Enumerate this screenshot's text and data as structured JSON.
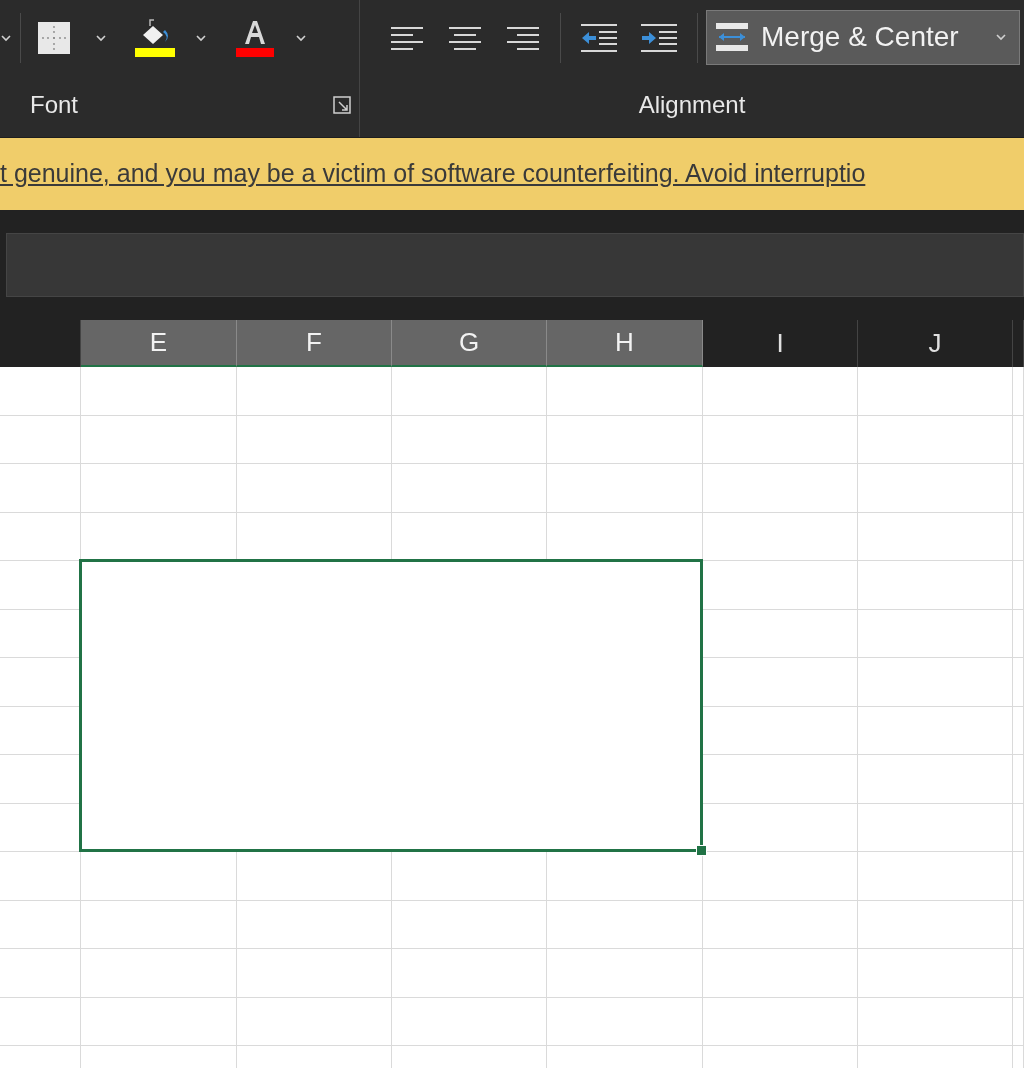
{
  "ribbon": {
    "font_group": {
      "label": "Font",
      "tools": [
        {
          "kind": "borders"
        },
        {
          "kind": "fill",
          "color": "#ffff00"
        },
        {
          "kind": "fontcolor",
          "color": "#ff0000"
        }
      ]
    },
    "alignment_group": {
      "label": "Alignment",
      "tools": [
        {
          "kind": "left"
        },
        {
          "kind": "center"
        },
        {
          "kind": "right"
        },
        {
          "kind": "outdent"
        },
        {
          "kind": "indent"
        }
      ],
      "merge_button": {
        "label": "Merge & Center"
      }
    }
  },
  "banner": {
    "text": "t genuine, and you may be a victim of software counterfeiting. Avoid interruptio"
  },
  "columns": [
    {
      "selected": false
    },
    {
      "label": "E",
      "selected": true
    },
    {
      "label": "F",
      "selected": true
    },
    {
      "label": "G",
      "selected": true
    },
    {
      "label": "H",
      "selected": true
    },
    {
      "label": "I",
      "selected": false
    },
    {
      "label": "J",
      "selected": false
    },
    {
      "selected": false
    }
  ],
  "merged_cell": {
    "selected": true
  }
}
